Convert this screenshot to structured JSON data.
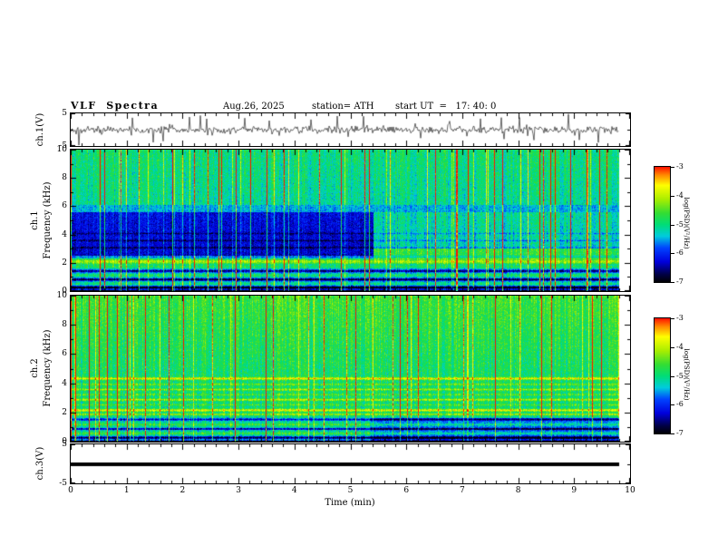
{
  "header": {
    "title": "VLF  Spectra",
    "date": "Aug.26, 2025",
    "station": "station= ATH",
    "start_ut": "start UT  =   17: 40: 0"
  },
  "xaxis": {
    "label": "Time (min)",
    "ticks": [
      0,
      1,
      2,
      3,
      4,
      5,
      6,
      7,
      8,
      9,
      10
    ],
    "range": [
      0,
      10
    ],
    "data_end_min": 9.8
  },
  "panels": {
    "ch1_wave": {
      "label": "ch.1(V)",
      "ylim": [
        -5,
        5
      ],
      "yticks": [
        5,
        -5
      ]
    },
    "ch1_spec": {
      "label_channel": "ch.1",
      "label_axis": "Frequency (kHz)",
      "ylim": [
        0,
        10
      ],
      "yticks": [
        10,
        8,
        6,
        4,
        2,
        0
      ]
    },
    "ch2_spec": {
      "label_channel": "ch.2",
      "label_axis": "Frequency (kHz)",
      "ylim": [
        0,
        10
      ],
      "yticks": [
        10,
        8,
        6,
        4,
        2,
        0
      ]
    },
    "ch3_wave": {
      "label": "ch.3(V)",
      "ylim": [
        -5,
        5
      ],
      "yticks": [
        5,
        -5
      ]
    }
  },
  "colorbar": {
    "label": "log(PSD)(V²/Hz)",
    "ticks": [
      -3,
      -4,
      -5,
      -6,
      -7
    ],
    "range": [
      -7,
      -3
    ]
  },
  "colormap": [
    {
      "t": 0.0,
      "c": "#000000"
    },
    {
      "t": 0.07,
      "c": "#000044"
    },
    {
      "t": 0.18,
      "c": "#0000dd"
    },
    {
      "t": 0.3,
      "c": "#0044ff"
    },
    {
      "t": 0.4,
      "c": "#00ccdd"
    },
    {
      "t": 0.5,
      "c": "#00dd77"
    },
    {
      "t": 0.6,
      "c": "#33dd33"
    },
    {
      "t": 0.72,
      "c": "#aaee00"
    },
    {
      "t": 0.84,
      "c": "#ffff00"
    },
    {
      "t": 0.93,
      "c": "#ff8800"
    },
    {
      "t": 1.0,
      "c": "#ff1100"
    }
  ],
  "chart_data": [
    {
      "id": "ch1_wave",
      "type": "line",
      "name": "ch.1(V) voltage trace",
      "ylabel": "ch.1(V)",
      "ylim": [
        -5,
        5
      ],
      "x_range_min": [
        0,
        9.8
      ],
      "summary": "Broadband VLF voltage trace: noisy signal centered on 0 V, rms about 0.8 V, with frequent impulsive sferic spikes reaching +/-3 to +/-5 V over the full 0-9.8 min record",
      "render": {
        "seed": 7,
        "sigma": 0.55,
        "spike_prob": 0.05,
        "spike_max": 3.8
      }
    },
    {
      "id": "ch1_spec",
      "type": "heatmap",
      "name": "ch.1 spectrogram",
      "xlabel": "Time (min)",
      "ylabel": "Frequency (kHz)",
      "xlim": [
        0,
        10
      ],
      "ylim": [
        0,
        10
      ],
      "value_range": [
        -7,
        -3
      ],
      "value_label": "log(PSD)(V²/Hz)",
      "summary": "0-10 kHz spectrogram: green/cyan background near -5.3, dense vertical sferic streaks up to -3 (yellow/red) across all frequencies, deep-blue quiet wedge 2.5-5.6 kHz before about 5.4 min, bright emission line near 2.1 kHz, alternating dark/black and green horizontal bands below 1.5 kHz",
      "render": {
        "seed": 11,
        "base": -5.35,
        "noise": 0.45,
        "fgrad": 0.4,
        "sferic_prob": 0.085,
        "sferic_strength": 2.3,
        "rects": [
          {
            "t0": 0,
            "t1": 5.4,
            "f0": 2.55,
            "f1": 5.6,
            "d": -1.05
          },
          {
            "t0": 5.4,
            "t1": 9.8,
            "f0": 2.3,
            "f1": 3.05,
            "d": 0.55
          },
          {
            "t0": 0,
            "t1": 9.8,
            "f0": 5.6,
            "f1": 6.1,
            "d": -0.35
          }
        ],
        "bands": [
          {
            "f": 2.12,
            "w": 0.18,
            "d": 1.15
          },
          {
            "f": 2.45,
            "w": 0.1,
            "d": -0.5
          },
          {
            "f": 1.75,
            "w": 0.09,
            "d": 0.5
          },
          {
            "f": 1.45,
            "w": 0.09,
            "d": -1.35
          },
          {
            "f": 1.15,
            "w": 0.09,
            "d": 0.45
          },
          {
            "f": 0.85,
            "w": 0.09,
            "d": -1.6
          },
          {
            "f": 0.55,
            "w": 0.09,
            "d": 0.35
          },
          {
            "f": 0.28,
            "w": 0.1,
            "d": -1.9
          },
          {
            "f": 0.05,
            "w": 0.07,
            "d": -2.2
          },
          {
            "f": 3.1,
            "w": 0.06,
            "d": -0.5
          },
          {
            "f": 3.6,
            "w": 0.06,
            "d": -0.45
          },
          {
            "f": 4.1,
            "w": 0.06,
            "d": -0.4
          }
        ]
      }
    },
    {
      "id": "ch2_spec",
      "type": "heatmap",
      "name": "ch.2 spectrogram",
      "xlabel": "Time (min)",
      "ylabel": "Frequency (kHz)",
      "xlim": [
        0,
        10
      ],
      "ylim": [
        0,
        10
      ],
      "value_range": [
        -7,
        -3
      ],
      "value_label": "log(PSD)(V²/Hz)",
      "summary": "0-10 kHz spectrogram: green/yellow mottled background brighter toward high frequency, dense vertical sferic streaks, stack of narrow bright horizontal lines between 1.8 and 4.5 kHz, dark bands near 0.3, 0.9 and 1.55 kHz, bluer low-frequency strip after about 5.4 min",
      "render": {
        "seed": 23,
        "base": -5.15,
        "noise": 0.45,
        "fgrad": 0.55,
        "sferic_prob": 0.08,
        "sferic_strength": 2.0,
        "rects": [
          {
            "t0": 5.35,
            "t1": 9.8,
            "f0": 0,
            "f1": 1.65,
            "d": -0.5
          }
        ],
        "bands": [
          {
            "f": 4.35,
            "w": 0.08,
            "d": 1.2
          },
          {
            "f": 3.95,
            "w": 0.07,
            "d": 0.55
          },
          {
            "f": 3.6,
            "w": 0.07,
            "d": 0.8
          },
          {
            "f": 3.25,
            "w": 0.07,
            "d": 0.5
          },
          {
            "f": 2.9,
            "w": 0.08,
            "d": 0.9
          },
          {
            "f": 2.55,
            "w": 0.07,
            "d": 0.5
          },
          {
            "f": 2.18,
            "w": 0.09,
            "d": 1.25
          },
          {
            "f": 1.9,
            "w": 0.07,
            "d": 0.9
          },
          {
            "f": 1.55,
            "w": 0.08,
            "d": -1.25
          },
          {
            "f": 1.2,
            "w": 0.07,
            "d": 0.5
          },
          {
            "f": 0.9,
            "w": 0.07,
            "d": -1.45
          },
          {
            "f": 0.6,
            "w": 0.07,
            "d": 0.55
          },
          {
            "f": 0.3,
            "w": 0.09,
            "d": -1.7
          },
          {
            "f": 0.05,
            "w": 0.07,
            "d": -2.0
          }
        ]
      }
    },
    {
      "id": "ch3_wave",
      "type": "line",
      "name": "ch.3(V) voltage trace",
      "ylabel": "ch.3(V)",
      "ylim": [
        -5,
        5
      ],
      "x_range_min": [
        0,
        9.8
      ],
      "summary": "Flat heavy black line, constant approximately 0 V for the whole interval",
      "render": {
        "value": 0,
        "thickness": 4
      }
    }
  ]
}
